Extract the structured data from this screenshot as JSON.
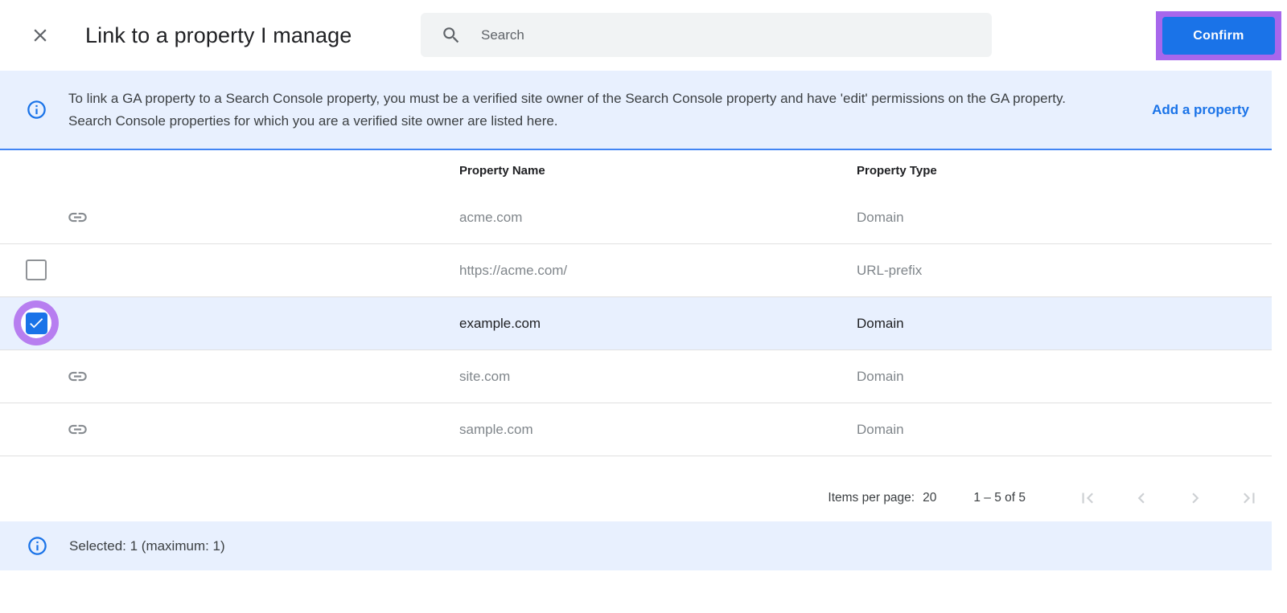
{
  "header": {
    "title": "Link to a property I manage",
    "search": {
      "placeholder": "Search"
    },
    "confirm_label": "Confirm"
  },
  "banner": {
    "text": "To link a GA property to a Search Console property, you must be a verified site owner of the Search Console property and have 'edit' permissions on the GA property. Search Console properties for which you are a verified site owner are listed here.",
    "link_label": "Add a property"
  },
  "table": {
    "columns": [
      "Property Name",
      "Property Type"
    ],
    "rows": [
      {
        "name": "acme.com",
        "type": "Domain",
        "leading": "link-icon",
        "selected": false,
        "highlighted": false
      },
      {
        "name": "https://acme.com/",
        "type": "URL-prefix",
        "leading": "checkbox-unchecked",
        "selected": false,
        "highlighted": false
      },
      {
        "name": "example.com",
        "type": "Domain",
        "leading": "checkbox-checked",
        "selected": true,
        "highlighted": true
      },
      {
        "name": "site.com",
        "type": "Domain",
        "leading": "link-icon",
        "selected": false,
        "highlighted": false
      },
      {
        "name": "sample.com",
        "type": "Domain",
        "leading": "link-icon",
        "selected": false,
        "highlighted": false
      }
    ]
  },
  "pagination": {
    "items_per_page_label": "Items per page:",
    "items_per_page_value": "20",
    "range_label": "1 – 5 of 5"
  },
  "footer": {
    "selected_text": "Selected: 1 (maximum: 1)"
  },
  "colors": {
    "accent_blue": "#1a73e8",
    "banner_blue_bg": "#e8f0fe",
    "banner_border_blue": "#4285f4",
    "highlight_purple": "#a767ec",
    "checkbox_ring_purple": "#b77ef0",
    "muted_text": "#80868b"
  }
}
